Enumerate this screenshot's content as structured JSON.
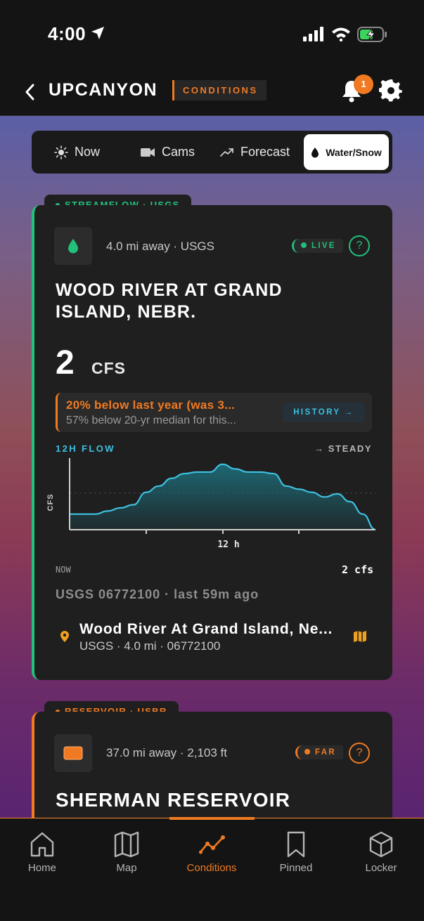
{
  "status_bar": {
    "time": "4:00"
  },
  "header": {
    "title": "UPCANYON",
    "section": "CONDITIONS",
    "notification_count": "1"
  },
  "tabs": [
    {
      "label": "Now",
      "icon": "sun-icon",
      "active": false
    },
    {
      "label": "Cams",
      "icon": "camera-icon",
      "active": false
    },
    {
      "label": "Forecast",
      "icon": "trend-icon",
      "active": false
    },
    {
      "label": "Water/Snow",
      "icon": "drop-icon",
      "active": true
    }
  ],
  "cards": [
    {
      "source_tag": "STREAMFLOW · USGS",
      "accent": "#22c07a",
      "meta": "4.0 mi away · USGS",
      "status": "LIVE",
      "help": "?",
      "site_name_line1": "WOOD RIVER AT GRAND",
      "site_name_line2": "ISLAND, NEBR.",
      "value": "2",
      "unit": "CFS",
      "alert_primary": "20% below last year (was 3...",
      "alert_secondary": "57% below 20-yr median for this...",
      "history_button": "HISTORY →",
      "flow_label": "12H FLOW",
      "trend": "→ STEADY",
      "chart_ylabel": "CFS",
      "chart_xlabel": "12 h",
      "now_label": "NOW",
      "current_label": "2 cfs",
      "gauge_line": "USGS 06772100 · last 59m ago",
      "location_name": "Wood River At Grand Island, Ne...",
      "location_sub": "USGS · 4.0 mi · 06772100"
    },
    {
      "source_tag": "RESERVOIR · USBR",
      "accent": "#f07a22",
      "meta": "37.0 mi away · 2,103 ft",
      "status": "FAR",
      "help": "?",
      "site_name": "SHERMAN RESERVOIR"
    }
  ],
  "chart_data": {
    "type": "area",
    "ylabel": "CFS",
    "xlabel": "12 h",
    "x": [
      0,
      1,
      2,
      3,
      4,
      5,
      6,
      7,
      8,
      9,
      10,
      11,
      12,
      13,
      14,
      15,
      16,
      17,
      18,
      19,
      20,
      21,
      22,
      23,
      24
    ],
    "values": [
      1.0,
      1.0,
      1.0,
      1.2,
      1.4,
      1.6,
      2.4,
      2.8,
      3.3,
      3.6,
      3.7,
      3.7,
      4.2,
      3.9,
      3.7,
      3.7,
      3.6,
      2.8,
      2.6,
      2.4,
      2.1,
      2.3,
      1.8,
      1.0,
      0.0
    ],
    "ylim": [
      0,
      4.6
    ]
  },
  "bottom_nav": [
    {
      "label": "Home",
      "icon": "home-icon",
      "active": false
    },
    {
      "label": "Map",
      "icon": "map-icon",
      "active": false
    },
    {
      "label": "Conditions",
      "icon": "conditions-icon",
      "active": true
    },
    {
      "label": "Pinned",
      "icon": "bookmark-icon",
      "active": false
    },
    {
      "label": "Locker",
      "icon": "box-icon",
      "active": false
    }
  ],
  "colors": {
    "accent": "#f07a22",
    "live": "#22c07a",
    "flow": "#3ec0e0"
  }
}
